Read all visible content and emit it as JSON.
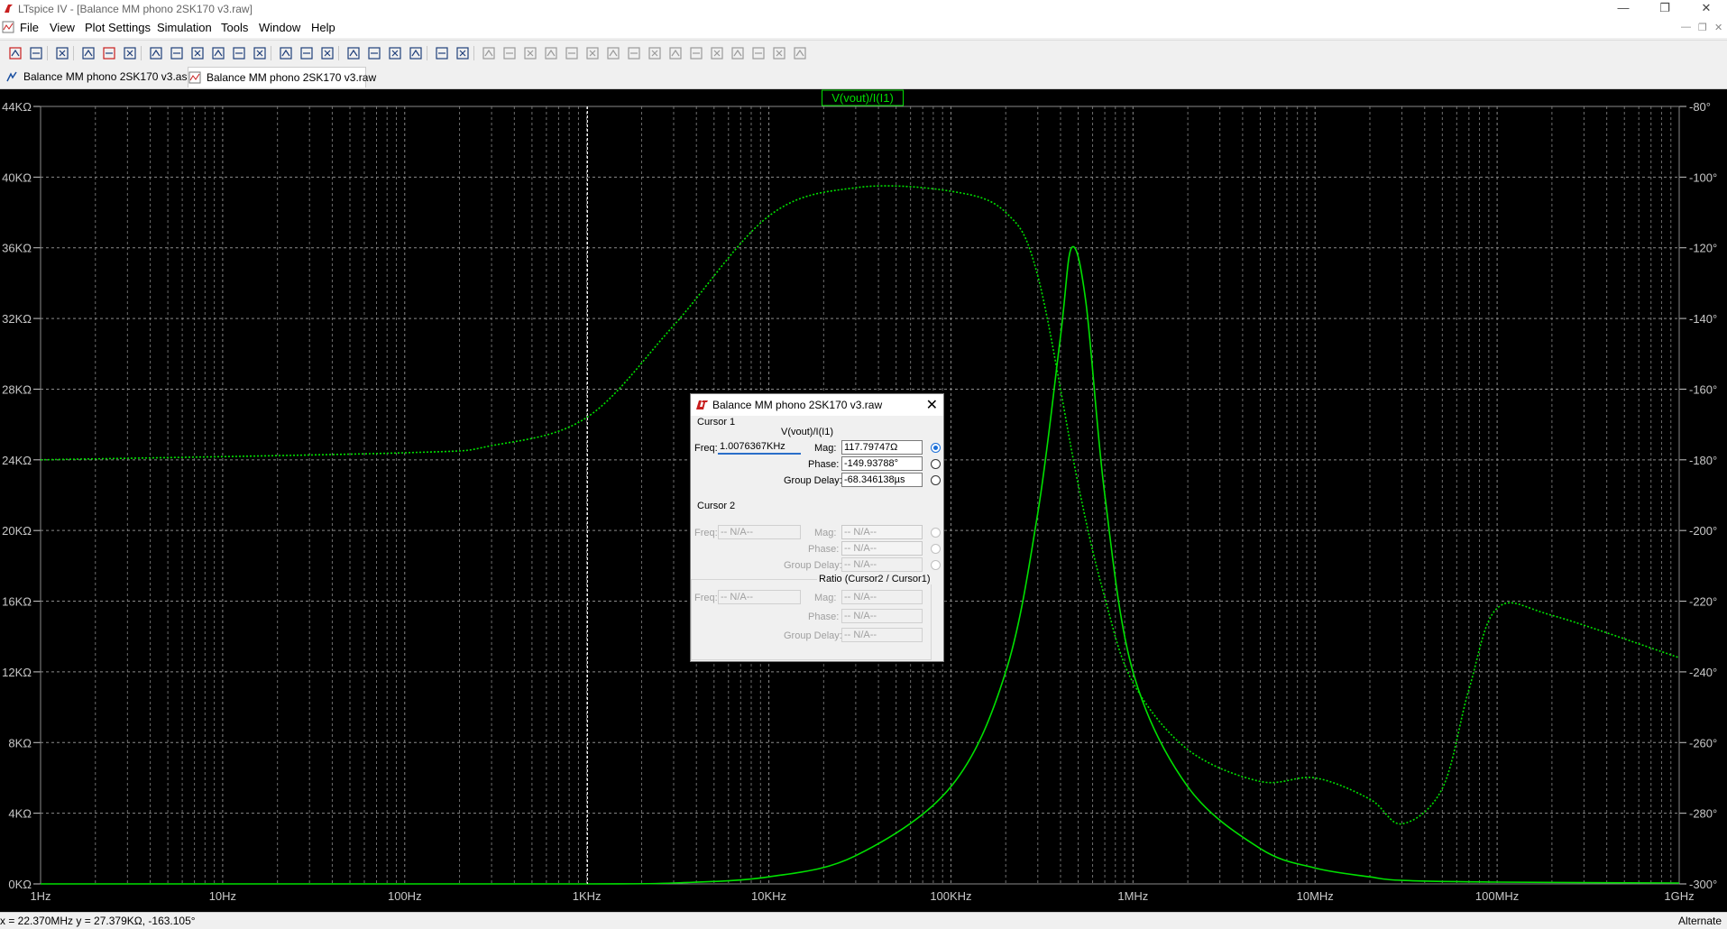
{
  "window": {
    "title": "LTspice IV - [Balance MM phono 2SK170 v3.raw]"
  },
  "menu": {
    "items": [
      "File",
      "View",
      "Plot Settings",
      "Simulation",
      "Tools",
      "Window",
      "Help"
    ]
  },
  "toolbar": {
    "icons": [
      "new-schematic-icon",
      "open-icon",
      "save-icon",
      "control-panel-icon",
      "run-icon",
      "halt-icon",
      "zoom-in-icon",
      "zoom-back-icon",
      "zoom-out-icon",
      "zoom-fit-icon",
      "autorange-icon",
      "zoom-extents-icon",
      "tile-horizontal-icon",
      "cascade-icon",
      "tile-vertical-icon",
      "cut-icon",
      "copy-icon",
      "paste-icon",
      "find-icon",
      "print-preview-icon",
      "print-icon",
      "wire-icon",
      "ground-icon",
      "label-icon",
      "resistor-icon",
      "capacitor-icon",
      "inductor-icon",
      "diode-icon",
      "component-icon",
      "move-icon",
      "drag-icon",
      "undo-icon",
      "redo-icon",
      "rotate-icon",
      "mirror-icon",
      "text-icon",
      "spice-directive-icon"
    ]
  },
  "tabs": [
    {
      "label": "Balance MM phono 2SK170 v3.asc",
      "icon": "schematic-icon"
    },
    {
      "label": "Balance MM phono 2SK170 v3.raw",
      "icon": "waveform-icon"
    }
  ],
  "plot": {
    "trace_label": "V(vout)/I(I1)",
    "colors": {
      "background": "#000000",
      "trace": "#00e000",
      "grid": "#8a8a8a",
      "text": "#c8c8c8",
      "cursor": "#ffffff"
    }
  },
  "chart_data": {
    "type": "line",
    "title": "V(vout)/I(I1)",
    "xscale": "log",
    "xlim": [
      1,
      1000000000
    ],
    "x_tick_labels": [
      "1Hz",
      "10Hz",
      "100Hz",
      "1KHz",
      "10KHz",
      "100KHz",
      "1MHz",
      "10MHz",
      "100MHz",
      "1GHz"
    ],
    "ylim_left": [
      0,
      44
    ],
    "y_left_unit": "KΩ",
    "y_left_tick_labels": [
      "0KΩ",
      "4KΩ",
      "8KΩ",
      "12KΩ",
      "16KΩ",
      "20KΩ",
      "24KΩ",
      "28KΩ",
      "32KΩ",
      "36KΩ",
      "40KΩ",
      "44KΩ"
    ],
    "ylim_right": [
      -300,
      -80
    ],
    "y_right_tick_labels": [
      "-80°",
      "-100°",
      "-120°",
      "-140°",
      "-160°",
      "-180°",
      "-200°",
      "-220°",
      "-240°",
      "-260°",
      "-280°",
      "-300°"
    ],
    "grid": true,
    "cursor_x": 1007.6367,
    "series": [
      {
        "style": "solid",
        "x": [
          1,
          100,
          1000,
          3000,
          10000,
          30000,
          100000,
          200000,
          300000,
          400000,
          460000,
          550000,
          700000,
          1000000,
          2000000,
          5000000,
          10000000,
          20000000,
          30000000,
          100000000,
          1000000000
        ],
        "values": [
          0,
          0,
          0,
          0.05,
          0.4,
          1.6,
          5.5,
          12,
          21,
          31,
          36,
          33,
          22,
          12,
          5.5,
          2,
          0.9,
          0.4,
          0.2,
          0.1,
          0.05
        ]
      },
      {
        "style": "dotted",
        "x": [
          1,
          100,
          300,
          1000,
          3000,
          10000,
          30000,
          100000,
          200000,
          300000,
          500000,
          700000,
          1000000,
          2000000,
          5000000,
          10000000,
          20000000,
          30000000,
          50000000,
          70000000,
          100000000,
          200000000,
          1000000000
        ],
        "values": [
          -180,
          -178,
          -176,
          -168,
          -142,
          -111,
          -103,
          -104,
          -110,
          -128,
          -187,
          -219,
          -243,
          -262,
          -271,
          -270,
          -276,
          -283,
          -273,
          -245,
          -222,
          -224,
          -236
        ]
      }
    ]
  },
  "cursor_dialog": {
    "title": "Balance MM phono 2SK170 v3.raw",
    "cursor1": {
      "header": "Cursor 1",
      "trace": "V(vout)/I(I1)",
      "freq_label": "Freq:",
      "freq": "1.0076367KHz",
      "mag_label": "Mag:",
      "mag": "117.79747Ω",
      "phase_label": "Phase:",
      "phase": "-149.93788°",
      "group_delay_label": "Group Delay:",
      "group_delay": "-68.346138µs"
    },
    "cursor2": {
      "header": "Cursor 2",
      "freq_label": "Freq:",
      "freq": "-- N/A--",
      "mag_label": "Mag:",
      "mag": "-- N/A--",
      "phase_label": "Phase:",
      "phase": "-- N/A--",
      "group_delay_label": "Group Delay:",
      "group_delay": "-- N/A--"
    },
    "ratio": {
      "header": "Ratio (Cursor2 / Cursor1)",
      "freq_label": "Freq:",
      "freq": "-- N/A--",
      "mag_label": "Mag:",
      "mag": "-- N/A--",
      "phase_label": "Phase:",
      "phase": "-- N/A--",
      "group_delay_label": "Group Delay:",
      "group_delay": "-- N/A--"
    }
  },
  "status": {
    "coords": "x = 22.370MHz   y = 27.379KΩ, -163.105°",
    "mode": "Alternate"
  }
}
